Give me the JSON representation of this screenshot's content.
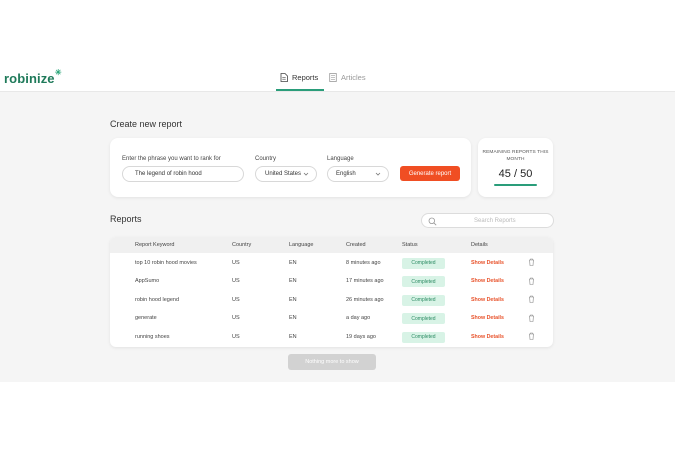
{
  "app": {
    "logo_text": "robinize",
    "brand_color": "#1f7a5a",
    "accent_color": "#2a9d7a",
    "cta_color": "#f04e23"
  },
  "nav": {
    "tabs": [
      {
        "label": "Reports",
        "icon": "document-icon",
        "active": true
      },
      {
        "label": "Articles",
        "icon": "article-icon",
        "active": false
      }
    ]
  },
  "create": {
    "title": "Create new report",
    "phrase_label": "Enter the phrase you want to rank for",
    "phrase_value": "The legend of robin hood",
    "country_label": "Country",
    "country_value": "United States",
    "language_label": "Language",
    "language_value": "English",
    "generate_label": "Generate report"
  },
  "remaining": {
    "label": "REMAINING REPORTS THIS MONTH",
    "value": "45 / 50",
    "used": 45,
    "total": 50
  },
  "reports": {
    "title": "Reports",
    "search_placeholder": "Search Reports",
    "columns": [
      "Report Keyword",
      "Country",
      "Language",
      "Created",
      "Status",
      "Details"
    ],
    "rows": [
      {
        "keyword": "top 10 robin hood movies",
        "country": "US",
        "language": "EN",
        "created": "8 minutes ago",
        "status": "Completed",
        "details": "Show Details"
      },
      {
        "keyword": "AppSumo",
        "country": "US",
        "language": "EN",
        "created": "17 minutes ago",
        "status": "Completed",
        "details": "Show Details"
      },
      {
        "keyword": "robin hood legend",
        "country": "US",
        "language": "EN",
        "created": "26 minutes ago",
        "status": "Completed",
        "details": "Show Details"
      },
      {
        "keyword": "generate",
        "country": "US",
        "language": "EN",
        "created": "a day ago",
        "status": "Completed",
        "details": "Show Details"
      },
      {
        "keyword": "running shoes",
        "country": "US",
        "language": "EN",
        "created": "19 days ago",
        "status": "Completed",
        "details": "Show Details"
      }
    ],
    "more_label": "Nothing more to show"
  }
}
